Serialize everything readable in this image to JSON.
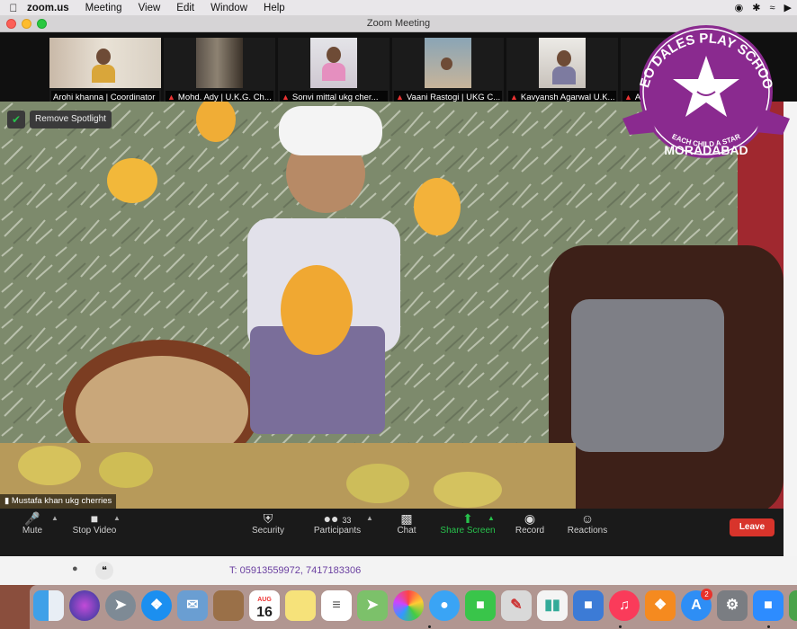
{
  "menubar": {
    "items": [
      "zoom.us",
      "Meeting",
      "View",
      "Edit",
      "Window",
      "Help"
    ]
  },
  "window": {
    "title": "Zoom Meeting"
  },
  "participants": [
    {
      "name": "Arohi khanna | Coordinator",
      "muted": false
    },
    {
      "name": "Mohd. Ady | U.K.G. Ch...",
      "muted": true
    },
    {
      "name": "Sonvi mittal ukg cher...",
      "muted": true
    },
    {
      "name": "Vaani Rastogi | UKG C...",
      "muted": true
    },
    {
      "name": "Kavyansh Agarwal U.K...",
      "muted": true
    },
    {
      "name": "Arav...",
      "muted": true
    }
  ],
  "spotlight": {
    "label": "Remove Spotlight"
  },
  "speaker": {
    "name": "Mustafa khan ukg cherries"
  },
  "logo": {
    "top_text": "NEO DALES PLAY SCHOOL",
    "ribbon_text": "EACH CHILD A STAR",
    "bottom_text": "MORADABAD"
  },
  "toolbar": {
    "mute": "Mute",
    "stop_video": "Stop Video",
    "security": "Security",
    "participants": "Participants",
    "participants_count": "33",
    "chat": "Chat",
    "share_screen": "Share Screen",
    "record": "Record",
    "reactions": "Reactions",
    "leave": "Leave"
  },
  "page": {
    "contact": "T:  05913559972, 7417183306"
  },
  "dock": {
    "calendar_month": "AUG",
    "calendar_day": "16",
    "appstore_badge": "2"
  },
  "colors": {
    "accent_green": "#27c24c",
    "leave_red": "#d8342b",
    "logo_purple": "#8a2a8f"
  }
}
